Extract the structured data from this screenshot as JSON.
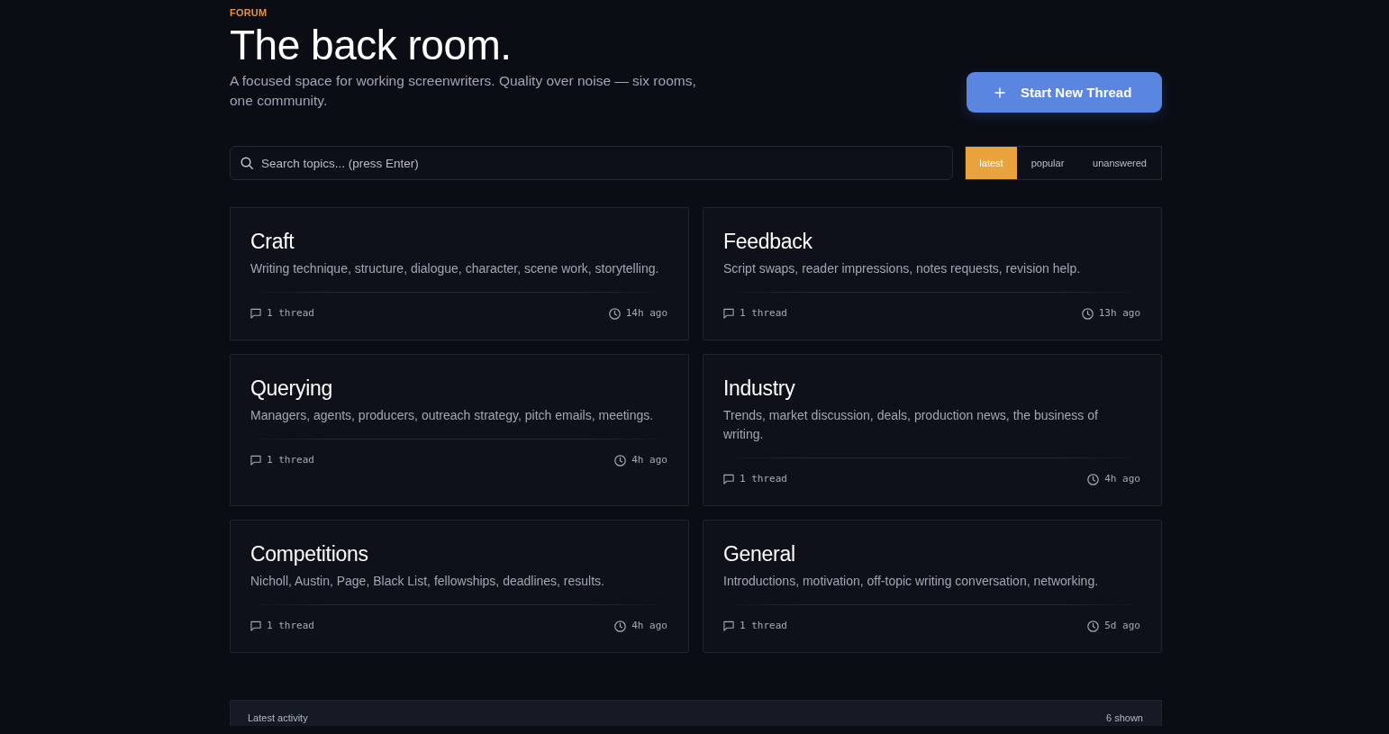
{
  "header": {
    "eyebrow": "FORUM",
    "title": "The back room.",
    "subtitle": "A focused space for working screenwriters. Quality over noise — six rooms, one community.",
    "new_thread_button": {
      "label": "Start New Thread"
    }
  },
  "search": {
    "placeholder": "Search topics... (press Enter)"
  },
  "sort_tabs": [
    {
      "label": "latest",
      "selected": true
    },
    {
      "label": "popular",
      "selected": false
    },
    {
      "label": "unanswered",
      "selected": false
    }
  ],
  "categories": [
    {
      "name": "Craft",
      "description": "Writing technique, structure, dialogue, character, scene work, storytelling.",
      "threads": "1 thread",
      "last_activity": "14h ago"
    },
    {
      "name": "Feedback",
      "description": "Script swaps, reader impressions, notes requests, revision help.",
      "threads": "1 thread",
      "last_activity": "13h ago"
    },
    {
      "name": "Querying",
      "description": "Managers, agents, producers, outreach strategy, pitch emails, meetings.",
      "threads": "1 thread",
      "last_activity": "4h ago"
    },
    {
      "name": "Industry",
      "description": "Trends, market discussion, deals, production news, the business of writing.",
      "threads": "1 thread",
      "last_activity": "4h ago"
    },
    {
      "name": "Competitions",
      "description": "Nicholl, Austin, Page, Black List, fellowships, deadlines, results.",
      "threads": "1 thread",
      "last_activity": "4h ago"
    },
    {
      "name": "General",
      "description": "Introductions, motivation, off-topic writing conversation, networking.",
      "threads": "1 thread",
      "last_activity": "5d ago"
    }
  ],
  "activity_panel": {
    "title": "Latest activity",
    "count": "6 shown"
  }
}
